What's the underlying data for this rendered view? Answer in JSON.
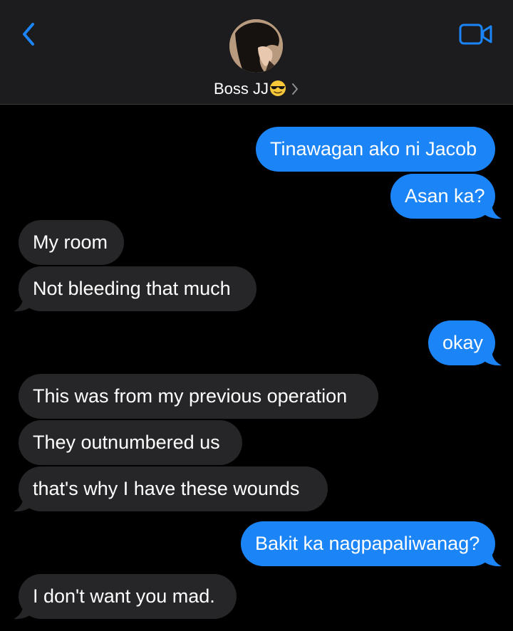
{
  "header": {
    "contact_name": "Boss JJ",
    "contact_emoji": "smiling-face-with-sunglasses",
    "back_icon": "chevron-left-icon",
    "video_icon": "video-camera-icon",
    "chevron_icon": "chevron-right-icon"
  },
  "colors": {
    "outgoing_bubble": "#1b84f7",
    "incoming_bubble": "#262628",
    "background": "#000000",
    "header": "#1c1c1e",
    "accent": "#1b84f7"
  },
  "messages": [
    {
      "direction": "outgoing",
      "text": "Tinawagan ako ni Jacob"
    },
    {
      "direction": "outgoing",
      "text": "Asan ka?"
    },
    {
      "direction": "incoming",
      "text": "My room"
    },
    {
      "direction": "incoming",
      "text": "Not bleeding that much"
    },
    {
      "direction": "outgoing",
      "text": "okay"
    },
    {
      "direction": "incoming",
      "text": "This was from my previous operation"
    },
    {
      "direction": "incoming",
      "text": "They outnumbered us"
    },
    {
      "direction": "incoming",
      "text": "that's why I have these wounds"
    },
    {
      "direction": "outgoing",
      "text": "Bakit ka nagpapaliwanag?"
    },
    {
      "direction": "incoming",
      "text": "I don't want you mad."
    }
  ]
}
